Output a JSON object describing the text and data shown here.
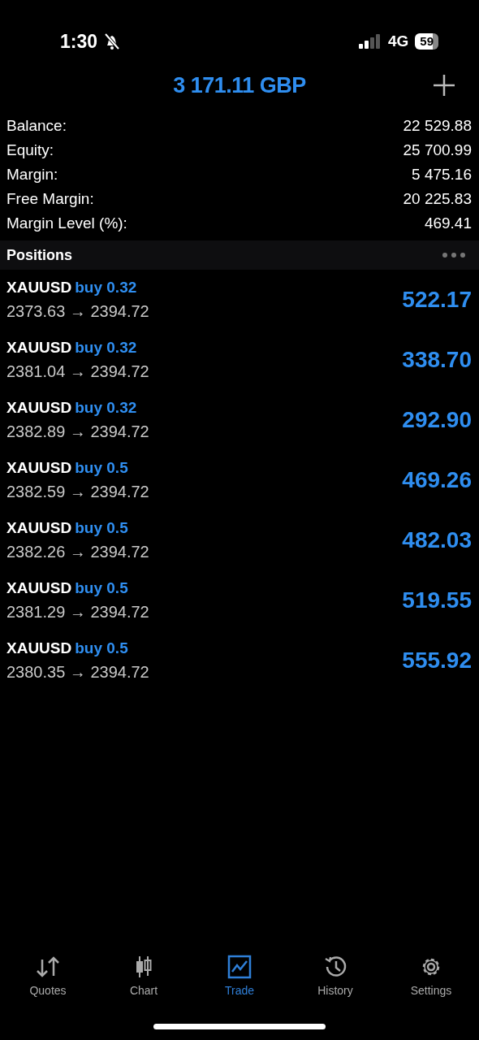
{
  "status_bar": {
    "time": "1:30",
    "network": "4G",
    "battery": "59"
  },
  "header": {
    "title": "3 171.11 GBP"
  },
  "summary": [
    {
      "label": "Balance:",
      "value": "22 529.88"
    },
    {
      "label": "Equity:",
      "value": "25 700.99"
    },
    {
      "label": "Margin:",
      "value": "5 475.16"
    },
    {
      "label": "Free Margin:",
      "value": "20 225.83"
    },
    {
      "label": "Margin Level (%):",
      "value": "469.41"
    }
  ],
  "positions_header": {
    "title": "Positions"
  },
  "positions": [
    {
      "symbol": "XAUUSD",
      "side": "buy 0.32",
      "prices": "2373.63 → 2394.72",
      "profit": "522.17"
    },
    {
      "symbol": "XAUUSD",
      "side": "buy 0.32",
      "prices": "2381.04 → 2394.72",
      "profit": "338.70"
    },
    {
      "symbol": "XAUUSD",
      "side": "buy 0.32",
      "prices": "2382.89 → 2394.72",
      "profit": "292.90"
    },
    {
      "symbol": "XAUUSD",
      "side": "buy 0.5",
      "prices": "2382.59 → 2394.72",
      "profit": "469.26"
    },
    {
      "symbol": "XAUUSD",
      "side": "buy 0.5",
      "prices": "2382.26 → 2394.72",
      "profit": "482.03"
    },
    {
      "symbol": "XAUUSD",
      "side": "buy 0.5",
      "prices": "2381.29 → 2394.72",
      "profit": "519.55"
    },
    {
      "symbol": "XAUUSD",
      "side": "buy 0.5",
      "prices": "2380.35 → 2394.72",
      "profit": "555.92"
    }
  ],
  "tab_bar": [
    {
      "label": "Quotes",
      "selected": false
    },
    {
      "label": "Chart",
      "selected": false
    },
    {
      "label": "Trade",
      "selected": true
    },
    {
      "label": "History",
      "selected": false
    },
    {
      "label": "Settings",
      "selected": false
    }
  ]
}
